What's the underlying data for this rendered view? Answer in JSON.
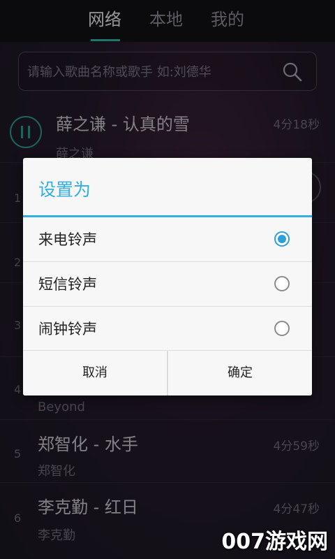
{
  "tabs": [
    {
      "label": "网络",
      "active": true
    },
    {
      "label": "本地",
      "active": false
    },
    {
      "label": "我的",
      "active": false
    }
  ],
  "search": {
    "placeholder": "请输入歌曲名称或歌手 如:刘德华",
    "icon": "search-icon"
  },
  "songs": [
    {
      "title": "薛之谦 - 认真的雪",
      "artist": "薛之谦",
      "duration": "4分18秒",
      "number": ""
    },
    {
      "title": "",
      "artist": "",
      "duration": "",
      "number": "1"
    },
    {
      "title": "",
      "artist": "",
      "duration": "",
      "number": "2"
    },
    {
      "title": "",
      "artist": "",
      "duration": "",
      "number": "3"
    },
    {
      "title": "",
      "artist": "Beyond",
      "duration": "",
      "number": "4"
    },
    {
      "title": "郑智化 - 水手",
      "artist": "郑智化",
      "duration": "4分59秒",
      "number": "5"
    },
    {
      "title": "李克勤 - 红日",
      "artist": "李克勤",
      "duration": "4分47秒",
      "number": "6"
    }
  ],
  "dialog": {
    "title": "设置为",
    "options": [
      {
        "label": "来电铃声",
        "checked": true
      },
      {
        "label": "短信铃声",
        "checked": false
      },
      {
        "label": "闹钟铃声",
        "checked": false
      }
    ],
    "cancel_label": "取消",
    "confirm_label": "确定"
  },
  "watermark": "007游戏网",
  "colors": {
    "accent": "#33aee0",
    "tab_indicator": "#2fb7a8",
    "play": "#2a9c8e"
  }
}
